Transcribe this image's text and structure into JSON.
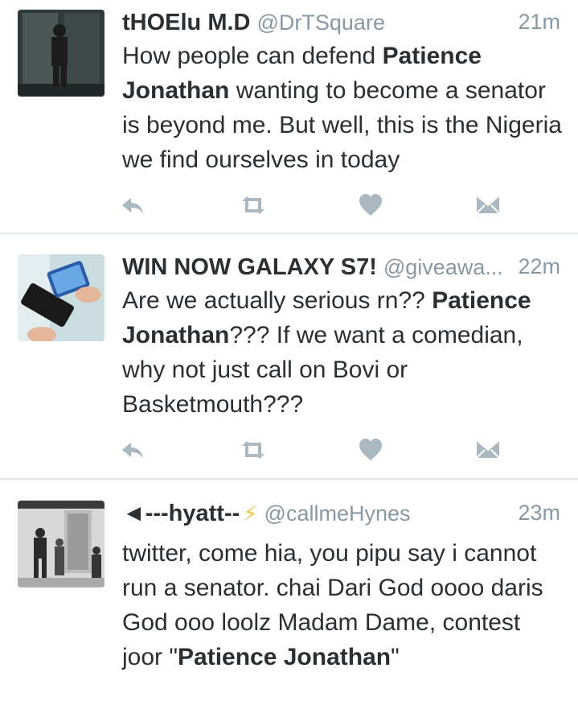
{
  "tweets": [
    {
      "name": "tHOElu M.D",
      "handle": "@DrTSquare",
      "time": "21m",
      "body": [
        {
          "text": "How people can defend ",
          "bold": false
        },
        {
          "text": "Patience Jonathan",
          "bold": true
        },
        {
          "text": " wanting to become a senator is beyond me. But well, this is the Nigeria we find ourselves in today",
          "bold": false
        }
      ]
    },
    {
      "name": "WIN NOW GALAXY S7!",
      "handle": "@giveawa...",
      "time": "22m",
      "body": [
        {
          "text": "Are we actually serious rn?? ",
          "bold": false
        },
        {
          "text": "Patience Jonathan",
          "bold": true
        },
        {
          "text": "??? If we want a comedian, why not just call on Bovi or Basketmouth???",
          "bold": false
        }
      ]
    },
    {
      "name": "◄---hyatt--",
      "badge": "⚡",
      "handle": "@callmeHynes",
      "time": "23m",
      "body": [
        {
          "text": "twitter, come hia, you pipu say i cannot run a senator. chai Dari God oooo daris God ooo loolz Madam Dame, contest joor \"",
          "bold": false
        },
        {
          "text": "Patience Jonathan",
          "bold": true
        },
        {
          "text": "\"",
          "bold": false
        }
      ]
    }
  ],
  "icons": {
    "reply": "reply-icon",
    "retweet": "retweet-icon",
    "like": "heart-icon",
    "dm": "direct-message-icon"
  },
  "colors": {
    "text": "#292f33",
    "muted": "#8899a6",
    "icon": "#aab8c2",
    "divider": "#e1e8ed"
  }
}
